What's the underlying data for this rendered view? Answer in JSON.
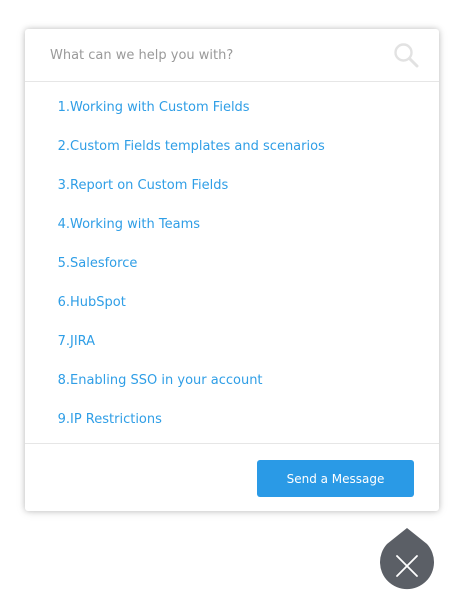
{
  "search": {
    "placeholder": "What can we help you with?"
  },
  "results": [
    {
      "number": "1.",
      "label": "Working with Custom Fields"
    },
    {
      "number": "2.",
      "label": "Custom Fields templates and scenarios"
    },
    {
      "number": "3.",
      "label": "Report on Custom Fields"
    },
    {
      "number": "4.",
      "label": "Working with Teams"
    },
    {
      "number": "5.",
      "label": "Salesforce"
    },
    {
      "number": "6.",
      "label": "HubSpot"
    },
    {
      "number": "7.",
      "label": "JIRA"
    },
    {
      "number": "8.",
      "label": "Enabling SSO in your account"
    },
    {
      "number": "9.",
      "label": "IP Restrictions"
    }
  ],
  "footer": {
    "send_label": "Send a Message"
  },
  "colors": {
    "link": "#2f9ee6",
    "button": "#2a9ae6",
    "launcher": "#5b5f66"
  },
  "icons": {
    "search": "search-icon",
    "close": "close-icon"
  }
}
